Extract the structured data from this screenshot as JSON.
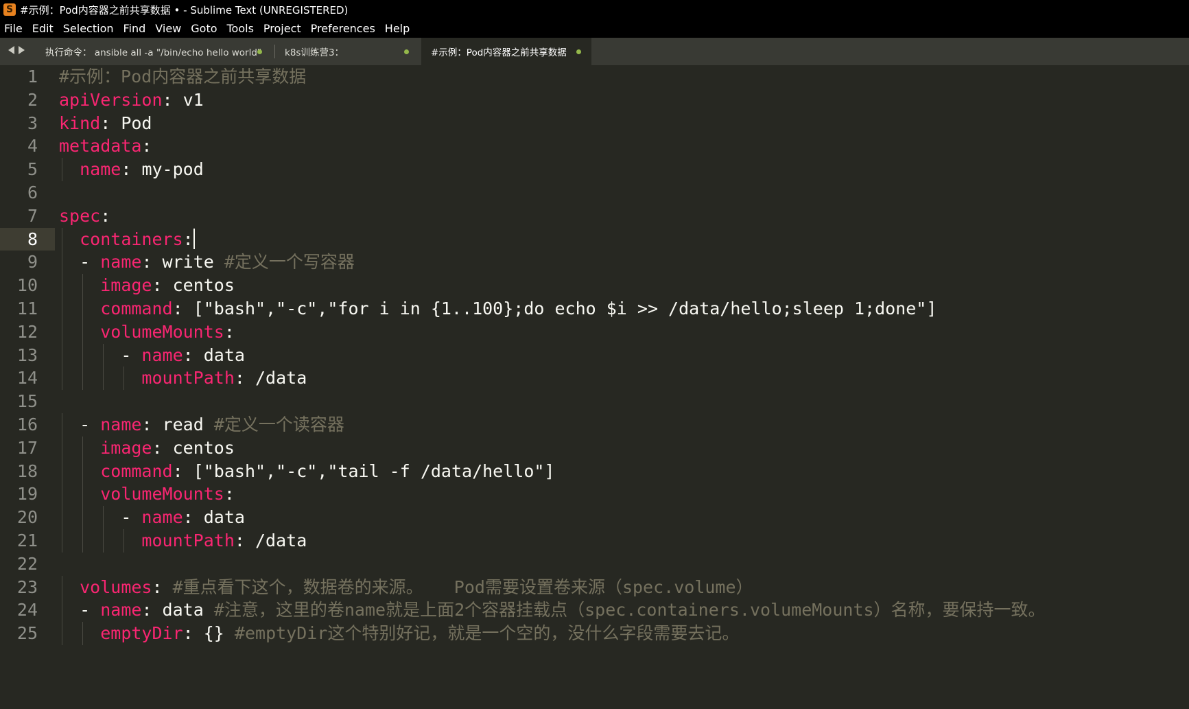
{
  "window": {
    "title": "#示例：Pod内容器之前共享数据 • - Sublime Text (UNREGISTERED)",
    "app_icon": "S"
  },
  "menu": {
    "items": [
      "File",
      "Edit",
      "Selection",
      "Find",
      "View",
      "Goto",
      "Tools",
      "Project",
      "Preferences",
      "Help"
    ]
  },
  "tabs": [
    {
      "label": "执行命令： ansible all -a \"/bin/echo hello world\"",
      "modified": true,
      "active": false
    },
    {
      "label": "k8s训练营3：",
      "modified": true,
      "active": false
    },
    {
      "label": "#示例：Pod内容器之前共享数据",
      "modified": true,
      "active": true
    }
  ],
  "editor": {
    "current_line": 8,
    "colors": {
      "background": "#272822",
      "key": "#f92672",
      "value": "#f8f8f2",
      "comment": "#75715e",
      "modified_dot": "#94b84b"
    },
    "line_numbers": [
      "1",
      "2",
      "3",
      "4",
      "5",
      "6",
      "7",
      "8",
      "9",
      "10",
      "11",
      "12",
      "13",
      "14",
      "15",
      "16",
      "17",
      "18",
      "19",
      "20",
      "21",
      "22",
      "23",
      "24",
      "25"
    ],
    "lines": [
      "#示例：Pod内容器之前共享数据",
      "apiVersion: v1",
      "kind: Pod",
      "metadata:",
      "  name: my-pod",
      "",
      "spec:",
      "  containers:",
      "  - name: write #定义一个写容器",
      "    image: centos",
      "    command: [\"bash\",\"-c\",\"for i in {1..100};do echo $i >> /data/hello;sleep 1;done\"]",
      "    volumeMounts:",
      "      - name: data",
      "        mountPath: /data",
      "",
      "  - name: read #定义一个读容器",
      "    image: centos",
      "    command: [\"bash\",\"-c\",\"tail -f /data/hello\"]",
      "    volumeMounts:",
      "      - name: data",
      "        mountPath: /data",
      "",
      "  volumes: #重点看下这个，数据卷的来源。   Pod需要设置卷来源（spec.volume）",
      "  - name: data #注意，这里的卷name就是上面2个容器挂载点（spec.containers.volumeMounts）名称，要保持一致。",
      "    emptyDir: {} #emptyDir这个特别好记，就是一个空的，没什么字段需要去记。"
    ]
  }
}
